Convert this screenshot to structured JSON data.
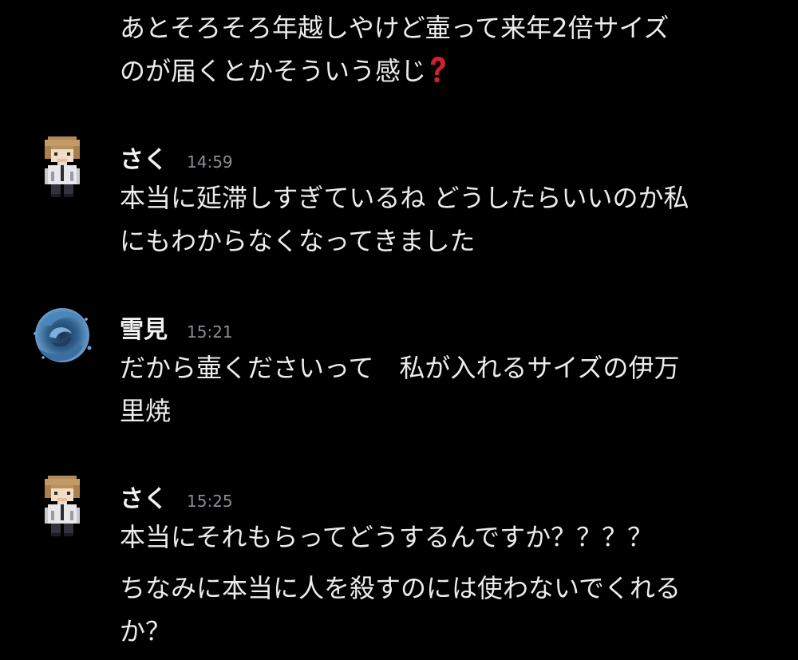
{
  "messages": [
    {
      "continuation": true,
      "lines": [
        "あとそろそろ年越しやけど壷って来年2倍サイズ",
        "のが届くとかそういう感じ"
      ],
      "emoji": "red-question-mark"
    },
    {
      "author": "さく",
      "time": "14:59",
      "avatar": "pixel-boy-avatar",
      "lines": [
        "本当に延滞しすぎているね どうしたらいいのか私",
        "にもわからなくなってきました"
      ]
    },
    {
      "author": "雪見",
      "time": "15:21",
      "avatar": "blue-swirl-avatar",
      "lines": [
        "だから壷くださいって　私が入れるサイズの伊万",
        "里焼"
      ]
    },
    {
      "author": "さく",
      "time": "15:25",
      "avatar": "pixel-boy-avatar",
      "lines": [
        "本当にそれもらってどうするんですか？？？？"
      ],
      "followup_lines": [
        "ちなみに本当に人を殺すのには使わないでくれる",
        "か？"
      ]
    }
  ],
  "colors": {
    "background": "#000000",
    "text": "#ececec",
    "timestamp": "#8a8d93",
    "emoji_red": "#d0202e"
  }
}
